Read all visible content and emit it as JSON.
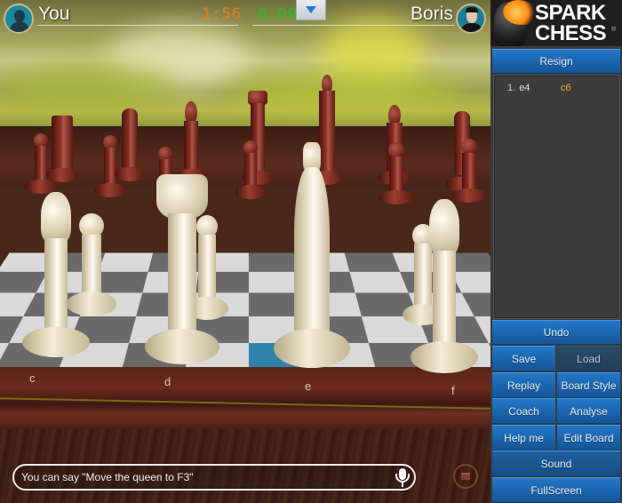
{
  "players": {
    "you": {
      "name": "You",
      "clock": "1:56",
      "clock_color": "#f07a1a",
      "avatar": "silhouette-avatar"
    },
    "opponent": {
      "name": "Boris",
      "clock": "0:00",
      "clock_color": "#22c022",
      "avatar": "boris-avatar"
    }
  },
  "menu_toggle": {
    "icon": "triangle-down-icon"
  },
  "logo": {
    "line1": "SPARK",
    "line2": "CHESS",
    "mark": "®"
  },
  "board": {
    "file_labels": [
      "c",
      "d",
      "e",
      "f"
    ],
    "highlight_color": "#2e83a8"
  },
  "panel": {
    "resign": "Resign",
    "moves": [
      {
        "number": "1.",
        "white": "e4",
        "black": "c6"
      }
    ],
    "undo": "Undo",
    "save": "Save",
    "load": "Load",
    "replay": "Replay",
    "board_style": "Board Style",
    "coach": "Coach",
    "analyse": "Analyse",
    "help_me": "Help me",
    "edit_board": "Edit Board",
    "sound": "Sound",
    "fullscreen": "FullScreen",
    "accent_color": "#1a64ad"
  },
  "voice": {
    "hint": "You can say \"Move the queen to F3\"",
    "mic_icon": "microphone-icon"
  }
}
